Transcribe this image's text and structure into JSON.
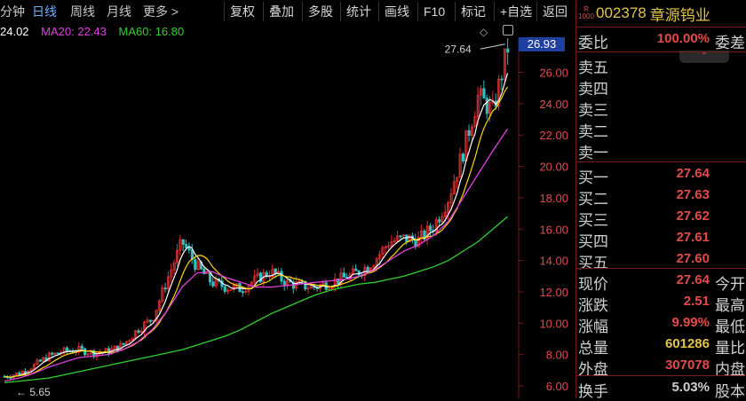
{
  "tabs": [
    {
      "label": "分钟",
      "active": false
    },
    {
      "label": "日线",
      "active": true
    },
    {
      "label": "周线",
      "active": false
    },
    {
      "label": "月线",
      "active": false
    },
    {
      "label": "更多 >",
      "active": false
    }
  ],
  "toolbar": [
    "复权",
    "叠加",
    "多股",
    "统计",
    "画线",
    "F10",
    "标记",
    "+自选",
    "返回"
  ],
  "ma": {
    "ma5_text": "24.02",
    "ma20_text": "MA20: 22.43",
    "ma60_text": "MA60: 16.80",
    "colors": {
      "ma5": "#ffffff",
      "ma10": "#ffd800",
      "ma20": "#e040e0",
      "ma60": "#30d030",
      "up": "#e03030",
      "down": "#30c0c0"
    }
  },
  "chart_data": {
    "type": "candlestick",
    "y_ticks": [
      "26.00",
      "24.00",
      "22.00",
      "20.00",
      "18.00",
      "16.00",
      "14.00",
      "12.00",
      "10.00",
      "8.00",
      "6.00"
    ],
    "ylim": [
      5.6,
      27.9
    ],
    "current_price": "26.93",
    "high_annotation": "27.64",
    "low_annotation": "5.65",
    "ma60": [
      6.2,
      6.3,
      6.4,
      6.5,
      6.7,
      6.9,
      7.1,
      7.3,
      7.5,
      7.7,
      7.9,
      8.1,
      8.3,
      8.6,
      8.9,
      9.2,
      9.6,
      10.1,
      10.6,
      11.0,
      11.4,
      11.8,
      12.1,
      12.3,
      12.5,
      12.6,
      12.8,
      13.0,
      13.3,
      13.6,
      14.0,
      14.6,
      15.2,
      16.0,
      16.8
    ],
    "ma20": [
      6.3,
      6.5,
      6.8,
      7.2,
      7.5,
      7.8,
      7.9,
      8.0,
      8.3,
      8.8,
      9.6,
      10.8,
      12.3,
      13.2,
      13.3,
      12.9,
      12.6,
      12.3,
      12.3,
      12.4,
      12.5,
      12.6,
      12.7,
      12.8,
      13.0,
      13.4,
      14.0,
      14.6,
      15.0,
      15.6,
      16.5,
      18.0,
      19.5,
      21.0,
      22.4
    ],
    "closes": [
      6.6,
      6.8,
      7.3,
      7.9,
      8.2,
      8.3,
      8.1,
      8.2,
      8.6,
      9.6,
      10.3,
      12.8,
      15.2,
      13.6,
      12.6,
      12.3,
      12.2,
      12.8,
      13.3,
      12.6,
      12.4,
      12.3,
      12.6,
      12.9,
      13.3,
      14.0,
      15.2,
      15.4,
      15.3,
      16.2,
      18.0,
      21.0,
      24.5,
      23.5,
      27.6
    ]
  },
  "quote": {
    "badge_top": "R",
    "badge_bottom": "1000",
    "code": "002378",
    "name": "章源钨业",
    "ratio_label": "委比",
    "ratio_value": "100.00%",
    "diff_label": "委差",
    "collapse_icon": "⌃",
    "asks": [
      {
        "label": "卖五"
      },
      {
        "label": "卖四"
      },
      {
        "label": "卖三"
      },
      {
        "label": "卖二"
      },
      {
        "label": "卖一"
      }
    ],
    "bids": [
      {
        "label": "买一",
        "price": "27.64"
      },
      {
        "label": "买二",
        "price": "27.63"
      },
      {
        "label": "买三",
        "price": "27.62"
      },
      {
        "label": "买四",
        "price": "27.61"
      },
      {
        "label": "买五",
        "price": "27.60"
      }
    ],
    "stats": [
      {
        "l": "现价",
        "v": "27.64",
        "r": "今开",
        "c": "#e24b4b"
      },
      {
        "l": "涨跌",
        "v": "2.51",
        "r": "最高",
        "c": "#e24b4b"
      },
      {
        "l": "涨幅",
        "v": "9.99%",
        "r": "最低",
        "c": "#e24b4b"
      },
      {
        "l": "总量",
        "v": "601286",
        "r": "量比",
        "c": "#e2c44b"
      },
      {
        "l": "外盘",
        "v": "307078",
        "r": "内盘",
        "c": "#e24b4b"
      }
    ],
    "turnover": {
      "l": "换手",
      "v": "5.03%",
      "r": "股本",
      "c": "#d0d0d0"
    }
  }
}
